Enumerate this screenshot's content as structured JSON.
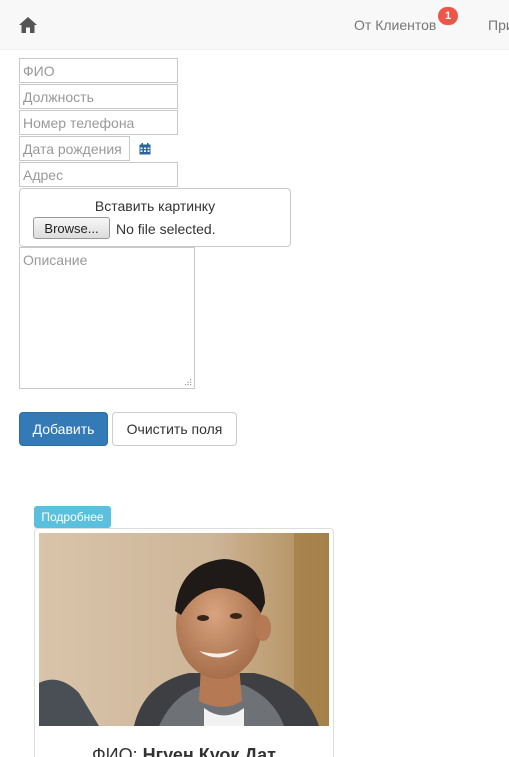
{
  "navbar": {
    "home_icon": "home-icon",
    "clients_label": "От Клиентов",
    "clients_badge": "1",
    "more_label": "При",
    "badge_color": "#f0554a"
  },
  "form": {
    "fio_placeholder": "ФИО",
    "position_placeholder": "Должность",
    "phone_placeholder": "Номер телефона",
    "dob_placeholder": "Дата рождения",
    "calendar_icon": "calendar-icon",
    "address_placeholder": "Адрес",
    "upload_label": "Вставить картинку",
    "browse_label": "Browse...",
    "file_status": "No file selected.",
    "description_placeholder": "Описание",
    "add_label": "Добавить",
    "clear_label": "Очистить поля",
    "primary_color": "#337ab7"
  },
  "card": {
    "details_label": "Подробнее",
    "details_color": "#5bc0de",
    "name_prefix": "ФИО: ",
    "name_value": "Нгуен Куок Дат"
  }
}
